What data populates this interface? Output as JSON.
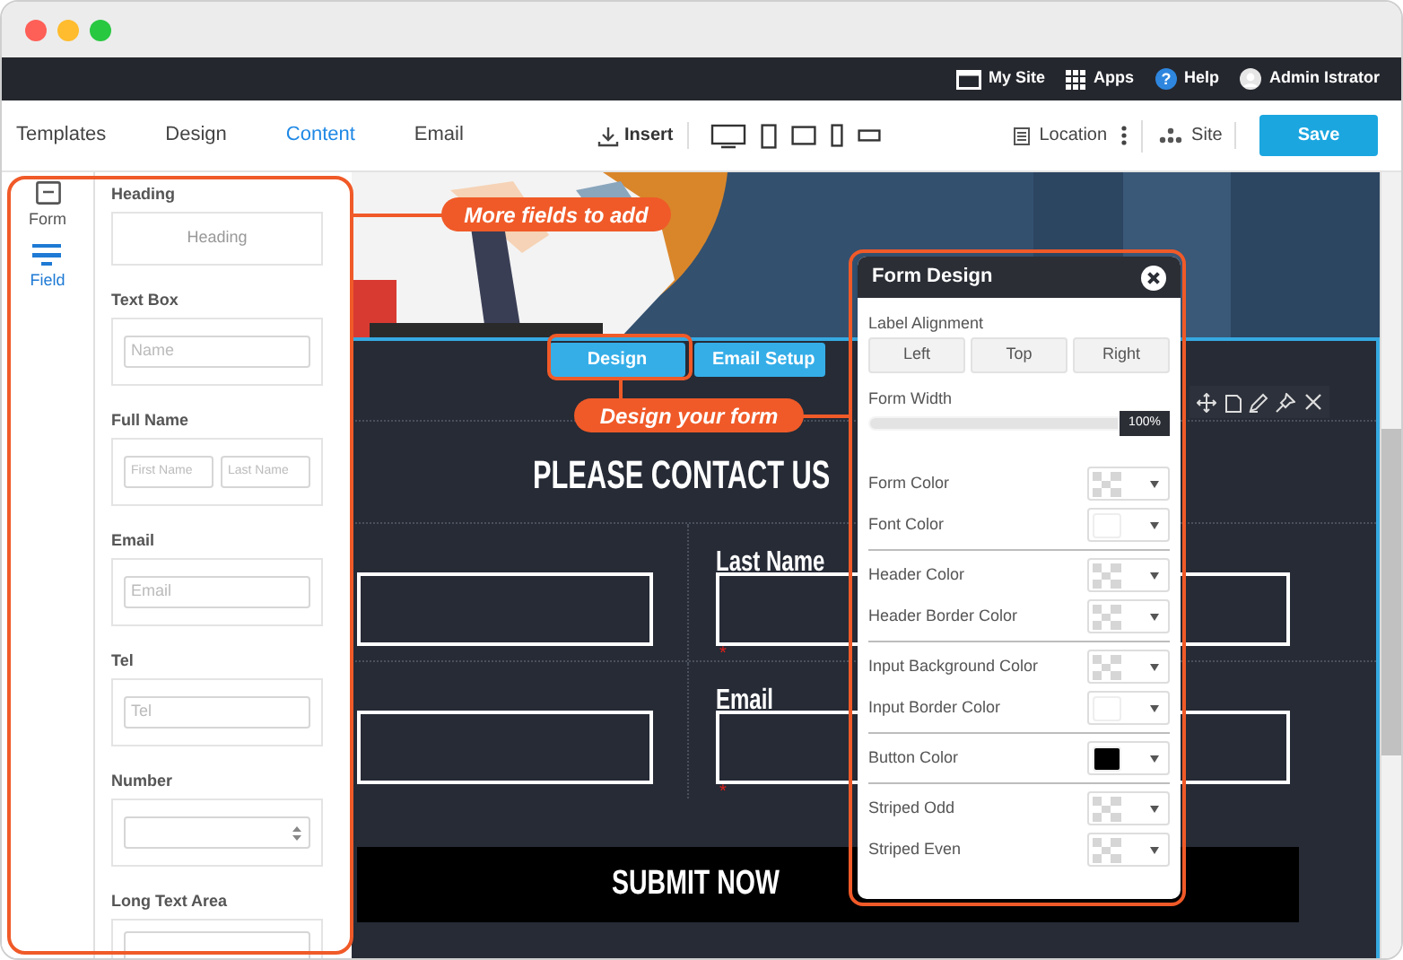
{
  "top_bar": {
    "items": [
      {
        "label": "My Site"
      },
      {
        "label": "Apps"
      },
      {
        "label": "Help",
        "badge": "?"
      },
      {
        "label": "Admin Istrator"
      }
    ]
  },
  "nav": {
    "tabs": [
      {
        "label": "Templates",
        "selected": false
      },
      {
        "label": "Design",
        "selected": false
      },
      {
        "label": "Content",
        "selected": true
      },
      {
        "label": "Email",
        "selected": false
      }
    ],
    "insert": "Insert",
    "location": "Location",
    "site": "Site",
    "save": "Save"
  },
  "sidebar": {
    "modes": [
      {
        "label": "Form",
        "selected": false
      },
      {
        "label": "Field",
        "selected": true
      }
    ],
    "fields": [
      {
        "label": "Heading",
        "kind": "heading",
        "preview": "Heading"
      },
      {
        "label": "Text Box",
        "kind": "input",
        "placeholders": [
          "Name"
        ]
      },
      {
        "label": "Full Name",
        "kind": "input",
        "placeholders": [
          "First Name",
          "Last Name"
        ]
      },
      {
        "label": "Email",
        "kind": "input",
        "placeholders": [
          "Email"
        ]
      },
      {
        "label": "Tel",
        "kind": "input",
        "placeholders": [
          "Tel"
        ]
      },
      {
        "label": "Number",
        "kind": "number"
      },
      {
        "label": "Long Text Area",
        "kind": "textarea"
      }
    ]
  },
  "callouts": [
    "More fields to add",
    "Design your form"
  ],
  "form_tabs": [
    "Design",
    "Email Setup"
  ],
  "form": {
    "heading": "PLEASE CONTACT US",
    "rows": [
      {
        "label": "Last Name",
        "mark": "*"
      },
      {
        "label": "Email",
        "mark": "*"
      }
    ],
    "submit": "SUBMIT NOW"
  },
  "design_panel": {
    "title": "Form Design",
    "alignment_label": "Label Alignment",
    "alignment_options": [
      "Left",
      "Top",
      "Right"
    ],
    "width": {
      "label": "Form Width",
      "level": 1,
      "reading": "100%"
    },
    "groups": [
      [
        {
          "label": "Form Color",
          "kind": "transparent"
        },
        {
          "label": "Font Color",
          "kind": "solid",
          "color": "#ffffff"
        }
      ],
      [
        {
          "label": "Header Color",
          "kind": "transparent"
        },
        {
          "label": "Header Border Color",
          "kind": "transparent"
        }
      ],
      [
        {
          "label": "Input Background Color",
          "kind": "transparent"
        },
        {
          "label": "Input Border Color",
          "kind": "solid",
          "color": "#ffffff"
        }
      ],
      [
        {
          "label": "Button Color",
          "kind": "solid",
          "color": "#000000"
        }
      ],
      [
        {
          "label": "Striped Odd",
          "kind": "transparent"
        },
        {
          "label": "Striped Even",
          "kind": "transparent"
        }
      ]
    ]
  }
}
